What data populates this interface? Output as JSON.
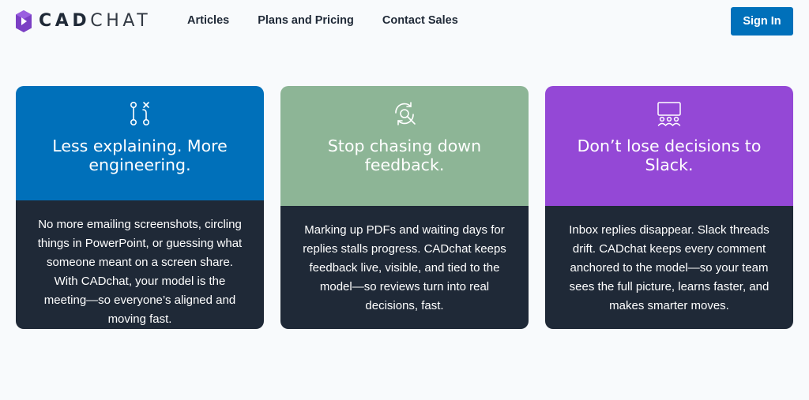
{
  "brand": {
    "name_part1": "CAD",
    "name_part2": "CHAT",
    "mark_color": "#7b3fc4"
  },
  "nav": {
    "items": [
      {
        "label": "Articles"
      },
      {
        "label": "Plans and Pricing"
      },
      {
        "label": "Contact Sales"
      }
    ]
  },
  "header": {
    "signin_label": "Sign In",
    "signin_color": "#0070ba"
  },
  "cards": [
    {
      "icon": "node-graph-icon",
      "color": "#0070ba",
      "title": "Less explaining. More engineering.",
      "body": "No more emailing screenshots, circling things in PowerPoint, or guessing what someone meant on a screen share. With CADchat, your model is the meeting—so everyone’s aligned and moving fast."
    },
    {
      "icon": "refresh-search-icon",
      "color": "#8db596",
      "title": "Stop chasing down feedback.",
      "body": "Marking up PDFs and waiting days for replies stalls progress. CADchat keeps feedback live, visible, and tied to the model—so reviews turn into real decisions, fast."
    },
    {
      "icon": "presentation-team-icon",
      "color": "#9448d6",
      "title": "Don’t lose decisions to Slack.",
      "body": "Inbox replies disappear. Slack threads drift. CADchat keeps every comment anchored to the model—so your team sees the full picture, learns faster, and makes smarter moves."
    }
  ]
}
